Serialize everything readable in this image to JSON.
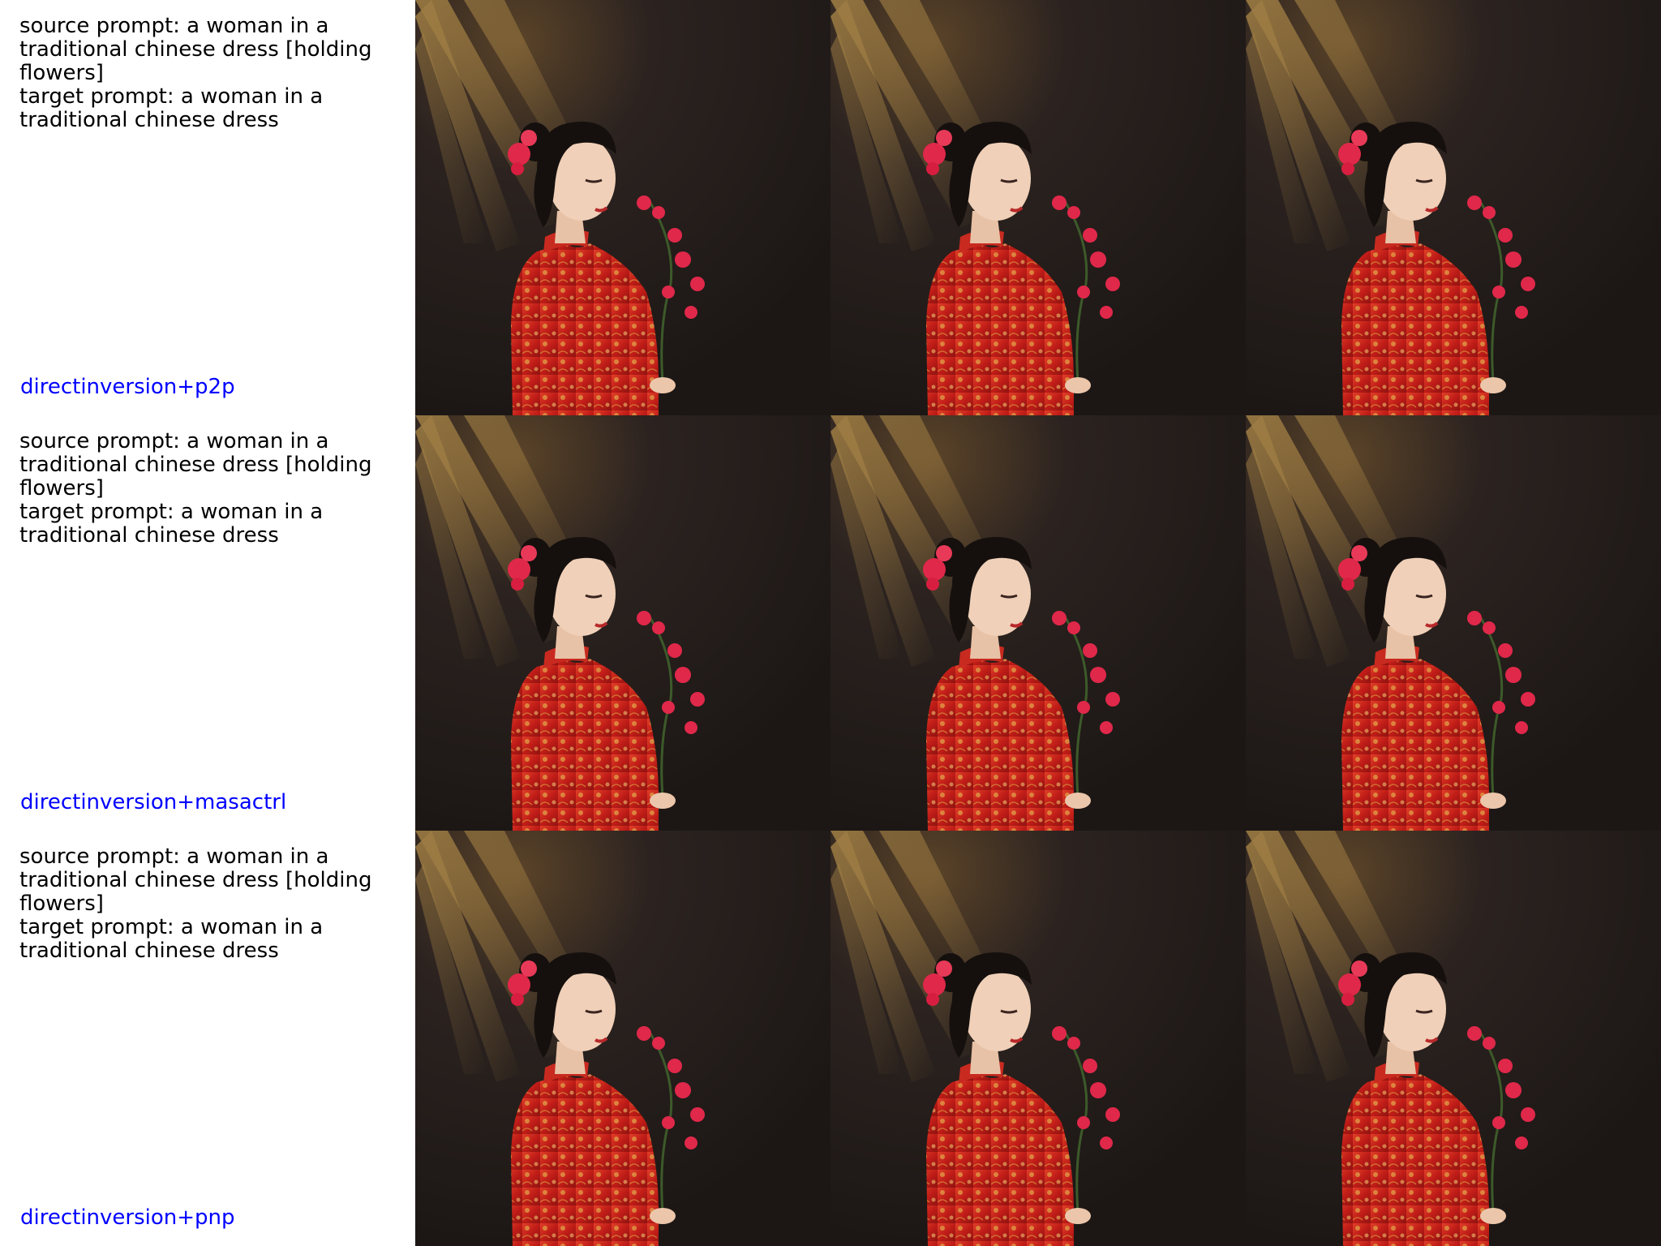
{
  "rows": [
    {
      "prompt": "source prompt: a woman in a\ntraditional chinese dress [holding\nflowers]\ntarget prompt: a woman in a\ntraditional chinese dress",
      "method": "directinversion+p2p"
    },
    {
      "prompt": "source prompt: a woman in a\ntraditional chinese dress [holding\nflowers]\ntarget prompt: a woman in a\ntraditional chinese dress",
      "method": "directinversion+masactrl"
    },
    {
      "prompt": "source prompt: a woman in a\ntraditional chinese dress [holding\nflowers]\ntarget prompt: a woman in a\ntraditional chinese dress",
      "method": "directinversion+pnp"
    }
  ],
  "colors": {
    "method_label": "#0000ff",
    "background_dark": "#221b19",
    "dress_red": "#c8201c",
    "dress_gold": "#d89a3a",
    "flower_pink": "#e0284a",
    "light_beam": "#e8b450"
  }
}
